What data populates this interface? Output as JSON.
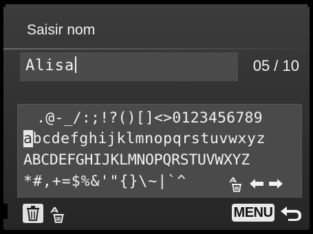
{
  "header": {
    "title": "Saisir nom"
  },
  "name_field": {
    "value": "Alisa",
    "count": "05 / 10"
  },
  "keyboard": {
    "rows": [
      " .@-_/:;!?()[]<>0123456789",
      "abcdefghijklmnopqrstuvwxyz",
      "ABCDEFGHIJKLMNOPQRSTUVWXYZ",
      "*#,+=$%&'\"{}\\~|`^"
    ],
    "selected_char": "a",
    "row2_rest": "bcdefghijklmnopqrstuvwxyz",
    "icons": [
      "clear-all-icon",
      "arrow-left-icon",
      "arrow-right-icon"
    ]
  },
  "footer": {
    "left_icons": [
      "trash-icon",
      "clear-all-icon"
    ],
    "menu_label": "MENU",
    "back_icon": "return-icon"
  }
}
